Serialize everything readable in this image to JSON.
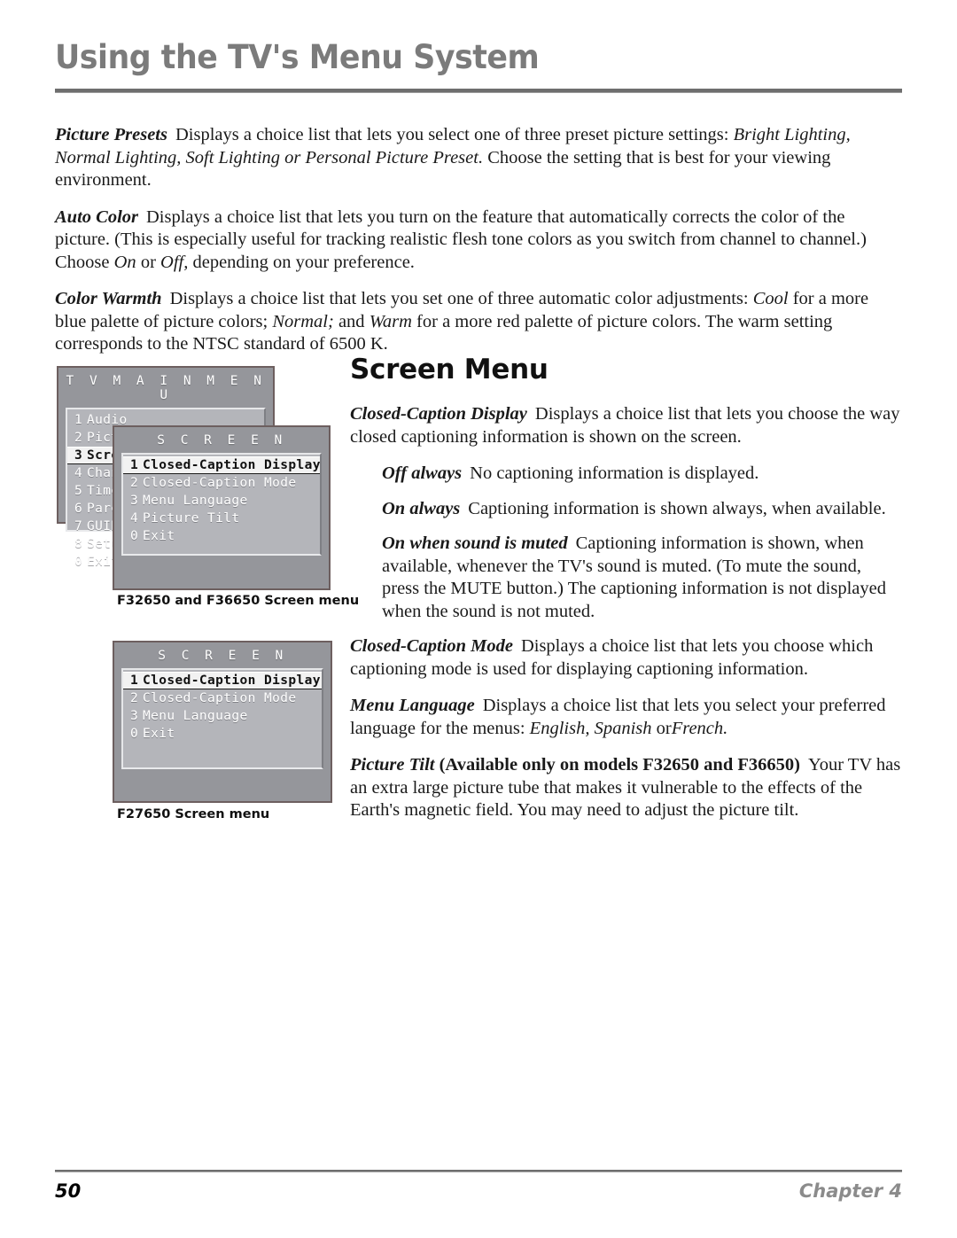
{
  "header": {
    "title": "Using the TV's Menu System"
  },
  "intro": {
    "picture_presets": {
      "term": "Picture Presets",
      "text_1": "Displays a choice list that lets you select one of three preset picture settings:",
      "italic_1": "Bright Lighting, Normal Lighting, Soft Lighting or Personal Picture Preset.",
      "text_2": "Choose the setting that is best for your viewing environment."
    },
    "auto_color": {
      "term": "Auto Color",
      "text_1": "Displays a choice list that lets you turn on the feature that automatically corrects the color of the picture. (This is especially useful for tracking realistic flesh tone colors as you switch from channel to channel.) Choose",
      "italic_on": "On",
      "text_or": "or",
      "italic_off": "Off,",
      "text_2": "depending on your preference."
    },
    "color_warmth": {
      "term": "Color Warmth",
      "text_1": "Displays a choice list that lets you set one of three automatic color adjustments:",
      "italic_cool": "Cool",
      "text_2": "for a more blue palette of picture colors;",
      "italic_normal": "Normal;",
      "text_3": "and",
      "italic_warm": "Warm",
      "text_4": "for a more red palette of picture colors. The warm setting corresponds to the NTSC standard of 6500 K."
    }
  },
  "right": {
    "heading": "Screen Menu",
    "cc_display": {
      "term": "Closed-Caption Display",
      "text": "Displays a choice list that lets you choose the way closed captioning information is shown on the screen."
    },
    "off_always": {
      "term": "Off always",
      "text": "No captioning information is displayed."
    },
    "on_always": {
      "term": "On always",
      "text": "Captioning information is shown always, when available."
    },
    "on_muted": {
      "term": "On when sound is muted",
      "text": "Captioning information is shown, when available, whenever the TV's sound is muted. (To mute the sound, press the MUTE button.) The captioning information is not displayed when the sound is not muted."
    },
    "cc_mode": {
      "term": "Closed-Caption Mode",
      "text": "Displays a choice list that lets you choose which captioning mode is used for displaying captioning information."
    },
    "menu_language": {
      "term": "Menu Language",
      "text_1": "Displays a choice list that lets you select your preferred language for the menus:",
      "italic_1": "English, Spanish",
      "text_or": "or",
      "italic_2": "French.",
      "text_2": ""
    },
    "picture_tilt": {
      "term": "Picture Tilt",
      "term_bold": "(Available only on models F32650 and F36650)",
      "text": "Your TV has an extra large picture tube that makes it vulnerable to the effects of the Earth's magnetic field. You may need to adjust the picture tilt."
    }
  },
  "tv_main_menu": {
    "title": "T V   M A I N   M E N U",
    "items": [
      {
        "num": "1",
        "label": "Audio",
        "selected": false
      },
      {
        "num": "2",
        "label": "Picture Quality",
        "selected": false
      },
      {
        "num": "3",
        "label": "Screen",
        "selected": true
      },
      {
        "num": "4",
        "label": "Channel",
        "selected": false
      },
      {
        "num": "5",
        "label": "Time",
        "selected": false
      },
      {
        "num": "6",
        "label": "Parental",
        "selected": false
      },
      {
        "num": "7",
        "label": "GUIDE Plus+",
        "selected": false
      },
      {
        "num": "8",
        "label": "Setup",
        "selected": false
      },
      {
        "num": "0",
        "label": "Exit",
        "selected": false
      }
    ]
  },
  "tv_screen_menu_a": {
    "title": "S C R E E N",
    "items": [
      {
        "num": "1",
        "label": "Closed-Caption Display",
        "selected": true
      },
      {
        "num": "2",
        "label": "Closed-Caption Mode",
        "selected": false
      },
      {
        "num": "3",
        "label": "Menu Language",
        "selected": false
      },
      {
        "num": "4",
        "label": "Picture Tilt",
        "selected": false
      },
      {
        "num": "0",
        "label": "Exit",
        "selected": false
      }
    ],
    "caption": "F32650 and F36650 Screen menu"
  },
  "tv_screen_menu_b": {
    "title": "S C R E E N",
    "items": [
      {
        "num": "1",
        "label": "Closed-Caption Display",
        "selected": true
      },
      {
        "num": "2",
        "label": "Closed-Caption Mode",
        "selected": false
      },
      {
        "num": "3",
        "label": "Menu Language",
        "selected": false
      },
      {
        "num": "0",
        "label": "Exit",
        "selected": false
      }
    ],
    "caption": "F27650 Screen menu"
  },
  "footer": {
    "page_number": "50",
    "chapter": "Chapter 4"
  },
  "colors": {
    "header_gray": "#7b7b7b",
    "panel_outer": "#95969b",
    "panel_inner": "#b4b5ba",
    "selected_row": "#f2f2f2",
    "footer_chapter_gray": "#8b8b8b"
  }
}
